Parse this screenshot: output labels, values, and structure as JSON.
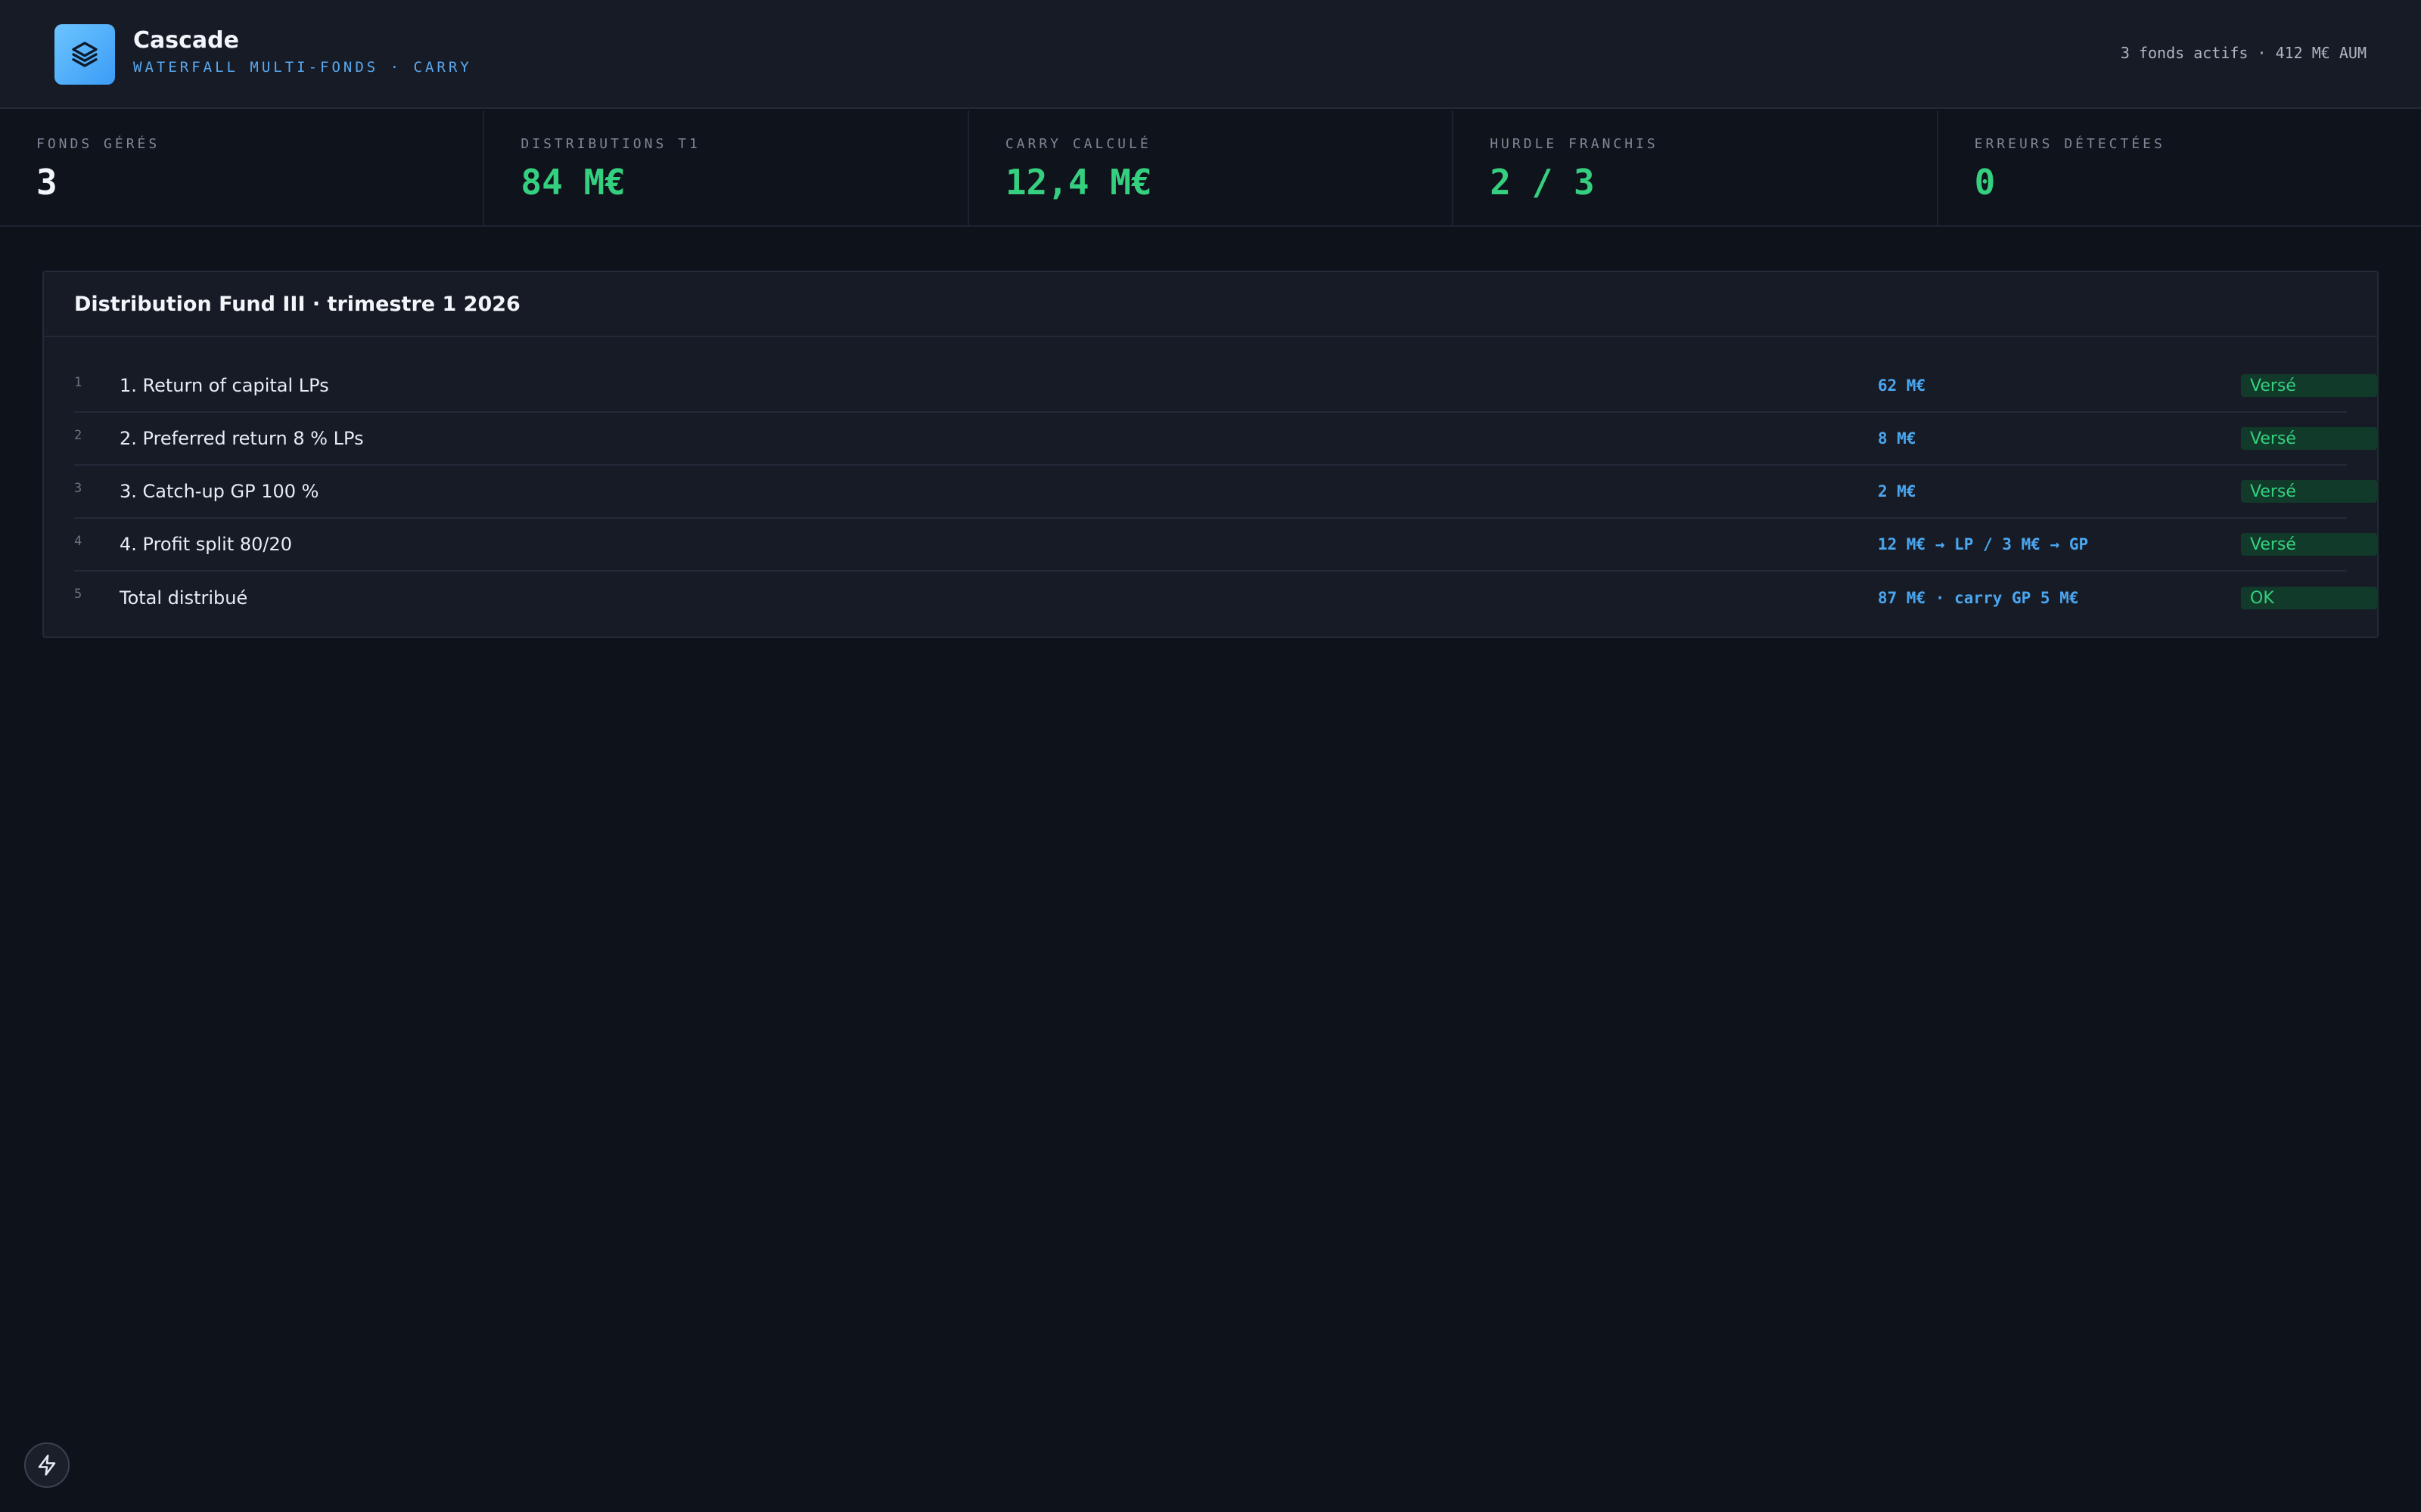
{
  "header": {
    "title": "Cascade",
    "subtitle": "WATERFALL MULTI-FONDS · CARRY",
    "meta": "3 fonds actifs · 412 M€ AUM",
    "logo_icon": "layers-icon"
  },
  "stats": [
    {
      "label": "FONDS GÉRÉS",
      "value": "3",
      "color": "#f2f5f9"
    },
    {
      "label": "DISTRIBUTIONS T1",
      "value": "84 M€",
      "color": "#35d07f"
    },
    {
      "label": "CARRY CALCULÉ",
      "value": "12,4 M€",
      "color": "#35d07f"
    },
    {
      "label": "HURDLE FRANCHIS",
      "value": "2 / 3",
      "color": "#35d07f"
    },
    {
      "label": "ERREURS DÉTECTÉES",
      "value": "0",
      "color": "#35d07f"
    }
  ],
  "panel": {
    "title": "Distribution Fund III · trimestre 1 2026",
    "rows": [
      {
        "index": "1",
        "label": "1. Return of capital LPs",
        "amount": "62 M€",
        "status": "Versé"
      },
      {
        "index": "2",
        "label": "2. Preferred return 8 % LPs",
        "amount": "8 M€",
        "status": "Versé"
      },
      {
        "index": "3",
        "label": "3. Catch-up GP 100 %",
        "amount": "2 M€",
        "status": "Versé"
      },
      {
        "index": "4",
        "label": "4. Profit split 80/20",
        "amount": "12 M€ → LP / 3 M€ → GP",
        "status": "Versé"
      },
      {
        "index": "5",
        "label": "Total distribué",
        "amount": "87 M€ · carry GP 5 M€",
        "status": "OK"
      }
    ]
  },
  "footer": {
    "icon": "lightning-icon"
  }
}
